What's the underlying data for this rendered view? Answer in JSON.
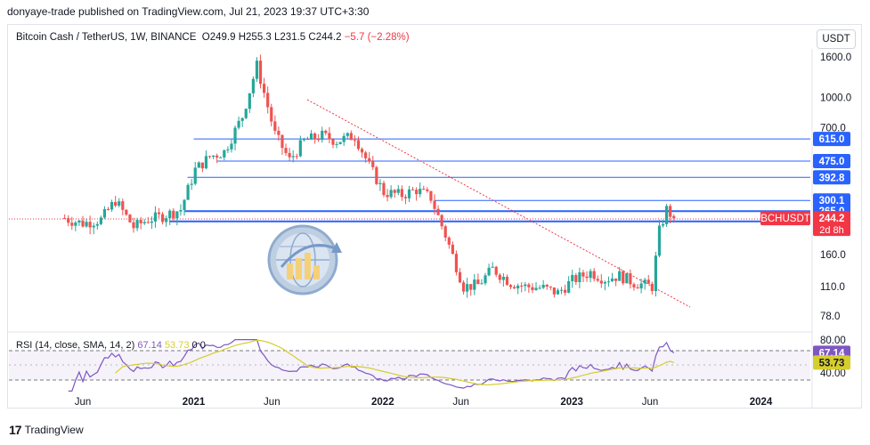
{
  "header": {
    "published": "donyaye-trade published on TradingView.com, Jul 21, 2023 19:37 UTC+3:30"
  },
  "symbol": {
    "name": "Bitcoin Cash / TetherUS, 1W, BINANCE",
    "open": "O249.9",
    "high": "H255.3",
    "low": "L231.5",
    "close": "C244.2",
    "change": "−5.7 (−2.28%)"
  },
  "currency_button": "USDT",
  "rsi_legend": {
    "label": "RSI (14, close, SMA, 14, 2)",
    "value1": "67.14",
    "value2": "53.73",
    "extra": "0  0"
  },
  "footer": {
    "brand": "TradingView"
  },
  "colors": {
    "up": "#26a69a",
    "down": "#ef5350",
    "level": "#2962ff",
    "trend": "#f23645",
    "rsi": "#7e57c2",
    "rsi_ma": "#d6cd2d",
    "badge": "#2962ff",
    "price_badge": "#f23645"
  },
  "chart_data": [
    {
      "type": "candlestick",
      "scale": "log",
      "x_ticks": [
        "Jun",
        "2021",
        "Jun",
        "2022",
        "Jun",
        "2023",
        "Jun",
        "2024"
      ],
      "y_ticks": [
        "1600.0",
        "1000.0",
        "700.0",
        "160.0",
        "110.0",
        "78.0"
      ],
      "horizontal_levels": [
        "615.0",
        "475.0",
        "392.8",
        "300.1",
        "265.0",
        "235.0"
      ],
      "current_price": "244.2",
      "current_symbol": "BCHUSDT",
      "countdown": "2d 8h",
      "close_path": [
        [
          "2020-05-04",
          240
        ],
        [
          "2020-06-01",
          230
        ],
        [
          "2020-07-06",
          240
        ],
        [
          "2020-08-03",
          300
        ],
        [
          "2020-09-07",
          220
        ],
        [
          "2020-10-05",
          240
        ],
        [
          "2020-11-02",
          250
        ],
        [
          "2020-12-07",
          270
        ],
        [
          "2021-01-04",
          430
        ],
        [
          "2021-02-01",
          500
        ],
        [
          "2021-03-01",
          530
        ],
        [
          "2021-04-05",
          800
        ],
        [
          "2021-05-03",
          1450
        ],
        [
          "2021-06-07",
          650
        ],
        [
          "2021-07-05",
          480
        ],
        [
          "2021-08-02",
          600
        ],
        [
          "2021-09-06",
          640
        ],
        [
          "2021-10-04",
          600
        ],
        [
          "2021-11-08",
          640
        ],
        [
          "2021-12-06",
          450
        ],
        [
          "2022-01-03",
          330
        ],
        [
          "2022-02-07",
          320
        ],
        [
          "2022-03-07",
          340
        ],
        [
          "2022-04-04",
          310
        ],
        [
          "2022-05-02",
          200
        ],
        [
          "2022-06-06",
          110
        ],
        [
          "2022-07-04",
          112
        ],
        [
          "2022-08-01",
          135
        ],
        [
          "2022-09-05",
          115
        ],
        [
          "2022-10-03",
          110
        ],
        [
          "2022-11-07",
          108
        ],
        [
          "2022-12-05",
          102
        ],
        [
          "2023-01-02",
          118
        ],
        [
          "2023-02-06",
          130
        ],
        [
          "2023-03-06",
          120
        ],
        [
          "2023-04-03",
          125
        ],
        [
          "2023-05-01",
          115
        ],
        [
          "2023-06-05",
          110
        ],
        [
          "2023-06-19",
          210
        ],
        [
          "2023-07-03",
          270
        ],
        [
          "2023-07-17",
          244.2
        ]
      ]
    },
    {
      "type": "line",
      "title": "RSI (14, close, SMA, 14, 2)",
      "y_ticks": [
        "80.00",
        "40.00"
      ],
      "series": [
        {
          "name": "RSI",
          "last": 67.14
        },
        {
          "name": "SMA",
          "last": 53.73
        }
      ]
    }
  ]
}
